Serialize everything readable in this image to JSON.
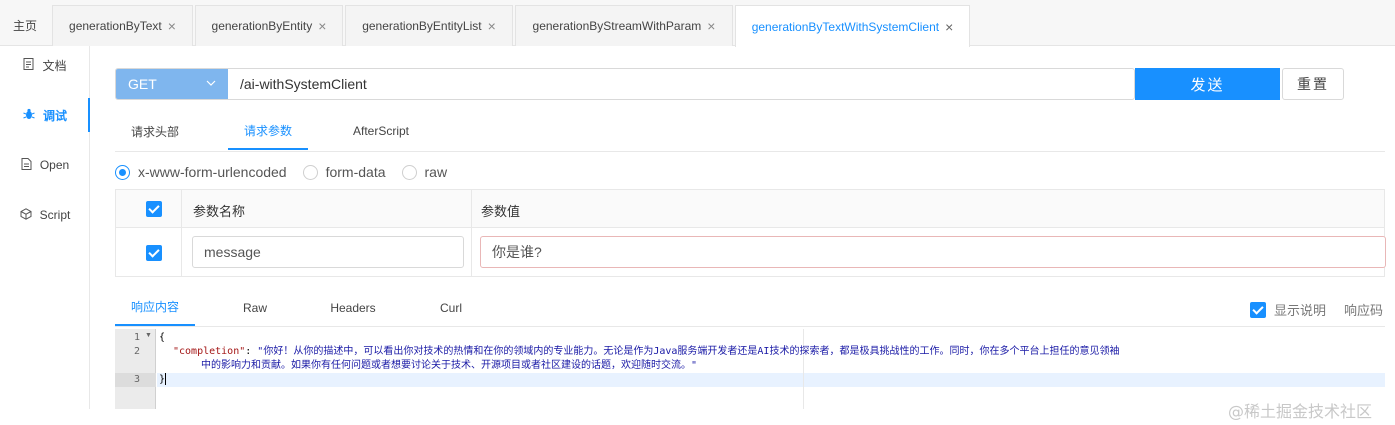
{
  "tabs": [
    {
      "label": "主页",
      "closable": false,
      "active": false
    },
    {
      "label": "generationByText",
      "closable": true,
      "active": false
    },
    {
      "label": "generationByEntity",
      "closable": true,
      "active": false
    },
    {
      "label": "generationByEntityList",
      "closable": true,
      "active": false
    },
    {
      "label": "generationByStreamWithParam",
      "closable": true,
      "active": false
    },
    {
      "label": "generationByTextWithSystemClient",
      "closable": true,
      "active": true
    }
  ],
  "sidebar": {
    "items": [
      {
        "label": "文档",
        "icon": "document-icon",
        "active": false
      },
      {
        "label": "调试",
        "icon": "bug-icon",
        "active": true
      },
      {
        "label": "Open",
        "icon": "file-icon",
        "active": false
      },
      {
        "label": "Script",
        "icon": "cube-icon",
        "active": false
      }
    ]
  },
  "request": {
    "method": "GET",
    "url": "/ai-withSystemClient",
    "send_label": "发送",
    "reset_label": "重置"
  },
  "request_tabs": [
    {
      "label": "请求头部",
      "active": false
    },
    {
      "label": "请求参数",
      "active": true
    },
    {
      "label": "AfterScript",
      "active": false
    }
  ],
  "body_types": [
    {
      "label": "x-www-form-urlencoded",
      "selected": true
    },
    {
      "label": "form-data",
      "selected": false
    },
    {
      "label": "raw",
      "selected": false
    }
  ],
  "params_table": {
    "headers": {
      "name": "参数名称",
      "value": "参数值"
    },
    "rows": [
      {
        "checked": true,
        "name": "message",
        "value": "你是谁?"
      }
    ]
  },
  "response_tabs": [
    {
      "label": "响应内容",
      "active": true
    },
    {
      "label": "Raw",
      "active": false
    },
    {
      "label": "Headers",
      "active": false
    },
    {
      "label": "Curl",
      "active": false
    }
  ],
  "response_options": {
    "show_description_label": "显示说明",
    "show_description_checked": true,
    "response_code_label": "响应码"
  },
  "response_body": {
    "line_numbers": [
      "1",
      "2",
      "",
      "3"
    ],
    "line1": "{",
    "line2_key": "\"completion\"",
    "line2_sep": ": ",
    "line2_value_part1": "\"你好！从你的描述中，可以看出你对技术的热情和在你的领域内的专业能力。无论是作为Java服务端开发者还是AI技术的探索者，都是极具挑战性的工作。同时，你在多个平台上担任的意见领袖",
    "line2_value_part2": "中的影响力和贡献。如果你有任何问题或者想要讨论关于技术、开源项目或者社区建设的话题，欢迎随时交流。\"",
    "line3": "}"
  },
  "watermark": "@稀土掘金技术社区",
  "colors": {
    "accent": "#1890ff",
    "method_bg": "#7fb6ee"
  }
}
